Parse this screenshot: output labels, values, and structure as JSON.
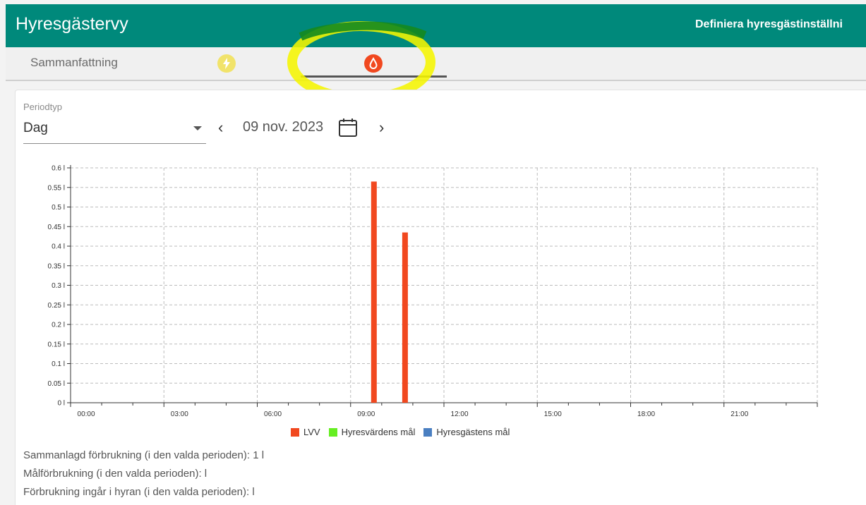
{
  "app": {
    "title": "Hyresgästervy",
    "settings_link": "Definiera hyresgästinställni"
  },
  "tabs": {
    "summary_label": "Sammanfattning",
    "electric_icon": "lightning-icon",
    "water_icon": "water-drop-icon",
    "active": "water"
  },
  "colors": {
    "appbar": "#00897b",
    "lvv": "#f1481f",
    "landlord_goal": "#66ee22",
    "tenant_goal": "#4a7fc1",
    "highlight": "#f5f500"
  },
  "filters": {
    "period_label": "Periodtyp",
    "period_value": "Dag",
    "date": "09 nov. 2023"
  },
  "chart_data": {
    "type": "bar",
    "x_ticks": [
      "00:00",
      "03:00",
      "06:00",
      "09:00",
      "12:00",
      "15:00",
      "18:00",
      "21:00"
    ],
    "y_ticks": [
      "0 l",
      "0.05 l",
      "0.1 l",
      "0.15 l",
      "0.2 l",
      "0.25 l",
      "0.3 l",
      "0.35 l",
      "0.4 l",
      "0.45 l",
      "0.5 l",
      "0.55 l",
      "0.6 l"
    ],
    "ylim": [
      0,
      0.6
    ],
    "xlim": [
      0,
      24
    ],
    "grid": true,
    "series": [
      {
        "name": "LVV",
        "color": "#f1481f",
        "points": [
          {
            "hour": 9.75,
            "value": 0.565
          },
          {
            "hour": 10.75,
            "value": 0.435
          }
        ]
      },
      {
        "name": "Hyresvärdens mål",
        "color": "#66ee22",
        "points": []
      },
      {
        "name": "Hyresgästens mål",
        "color": "#4a7fc1",
        "points": []
      }
    ]
  },
  "stats": {
    "total": "Sammanlagd förbrukning (i den valda perioden): 1 l",
    "goal": "Målförbrukning (i den valda perioden): l",
    "included": "Förbrukning ingår i hyran (i den valda perioden): l"
  }
}
